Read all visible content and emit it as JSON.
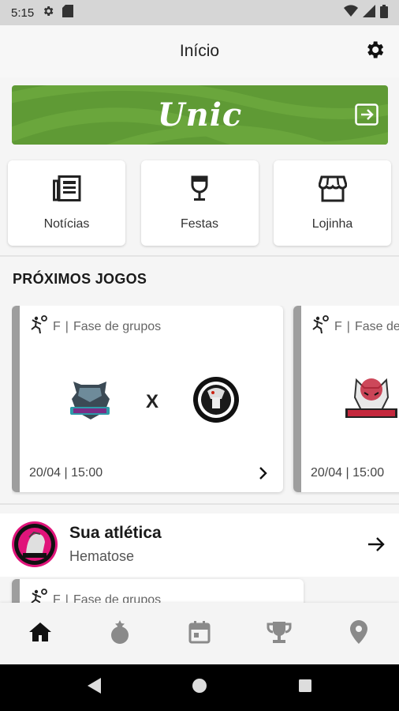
{
  "status_bar": {
    "time": "5:15",
    "icons": [
      "gear-icon",
      "sd-card-icon",
      "wifi-icon",
      "signal-icon",
      "battery-icon"
    ]
  },
  "app_bar": {
    "title": "Início",
    "settings_icon": "gear-icon"
  },
  "banner": {
    "logo_text": "Unic",
    "arrow_icon": "enter-arrow-icon",
    "color": "#5f9a35"
  },
  "shortcuts": [
    {
      "label": "Notícias",
      "icon": "newspaper-icon"
    },
    {
      "label": "Festas",
      "icon": "wine-glass-icon"
    },
    {
      "label": "Lojinha",
      "icon": "storefront-icon"
    }
  ],
  "upcoming": {
    "title": "PRÓXIMOS JOGOS",
    "games": [
      {
        "sport_icon": "handball-icon",
        "gender": "F",
        "phase": "Fase de grupos",
        "home_logo": "team-logo-hematose",
        "away_logo": "team-logo-circular-crest",
        "vs": "X",
        "datetime": "20/04 | 15:00"
      },
      {
        "sport_icon": "handball-icon",
        "gender": "F",
        "phase": "Fase de grupos",
        "home_logo": "team-logo-autoritaria",
        "datetime": "20/04 | 15:00"
      }
    ]
  },
  "athletic": {
    "title": "Sua atlética",
    "name": "Hematose",
    "arrow_icon": "arrow-right-icon",
    "accent": "#e0147a"
  },
  "athletic_games": [
    {
      "sport_icon": "handball-icon",
      "gender": "F",
      "phase": "Fase de grupos"
    }
  ],
  "bottom_nav": [
    {
      "name": "home-icon",
      "active": true
    },
    {
      "name": "medal-icon",
      "active": false
    },
    {
      "name": "calendar-icon",
      "active": false
    },
    {
      "name": "trophy-icon",
      "active": false
    },
    {
      "name": "location-pin-icon",
      "active": false
    }
  ],
  "system_nav": [
    "back-icon",
    "home-circle-icon",
    "recents-icon"
  ]
}
